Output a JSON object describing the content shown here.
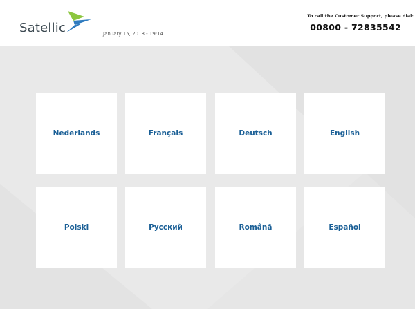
{
  "header": {
    "logo_text": "Satellic",
    "datetime": "January 15, 2018 - 19:14",
    "support_label": "To call the Customer Support, please dial:",
    "support_phone": "00800 - 72835542"
  },
  "languages": [
    {
      "label": "Nederlands"
    },
    {
      "label": "Français"
    },
    {
      "label": "Deutsch"
    },
    {
      "label": "English"
    },
    {
      "label": "Polski"
    },
    {
      "label": "Русский"
    },
    {
      "label": "Română"
    },
    {
      "label": "Español"
    }
  ],
  "colors": {
    "accent_blue": "#1a5f96",
    "logo_green": "#8cc63f",
    "logo_blue": "#2f7bbf",
    "background": "#e6e6e6"
  }
}
